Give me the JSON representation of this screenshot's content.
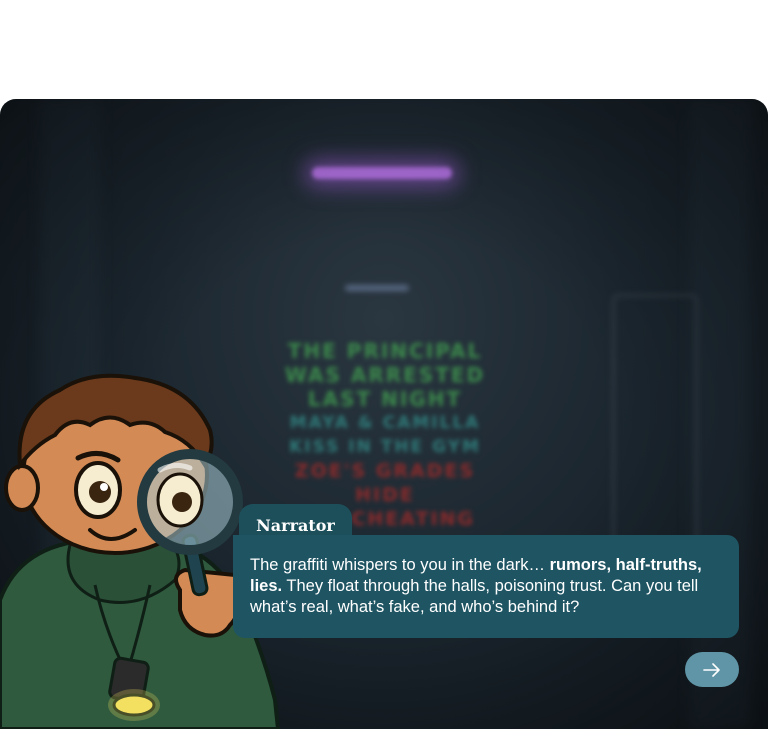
{
  "scene": {
    "graffiti": {
      "line1": "THE PRINCIPAL",
      "line2": "WAS ARRESTED",
      "line3": "LAST NIGHT",
      "line4": "MAYA & CAMILLA",
      "line5": "KISS IN THE GYM",
      "line6": "ZOE'S GRADES HIDE",
      "line7": "THE CHEATING"
    }
  },
  "dialogue": {
    "speaker": "Narrator",
    "text_part1": "The graffiti whispers to you in the dark… ",
    "text_bold": "rumors, half-truths, lies.",
    "text_part2": " They float through the halls, poisoning trust. Can you tell what’s real, what’s fake, and who’s behind it?"
  },
  "controls": {
    "next_icon": "arrow-right-icon"
  },
  "colors": {
    "dialogue_bg": "#1f5563",
    "name_tag_bg": "#1d4f5a",
    "next_button_bg": "#5f95a6",
    "neon_light": "#b070e0"
  }
}
